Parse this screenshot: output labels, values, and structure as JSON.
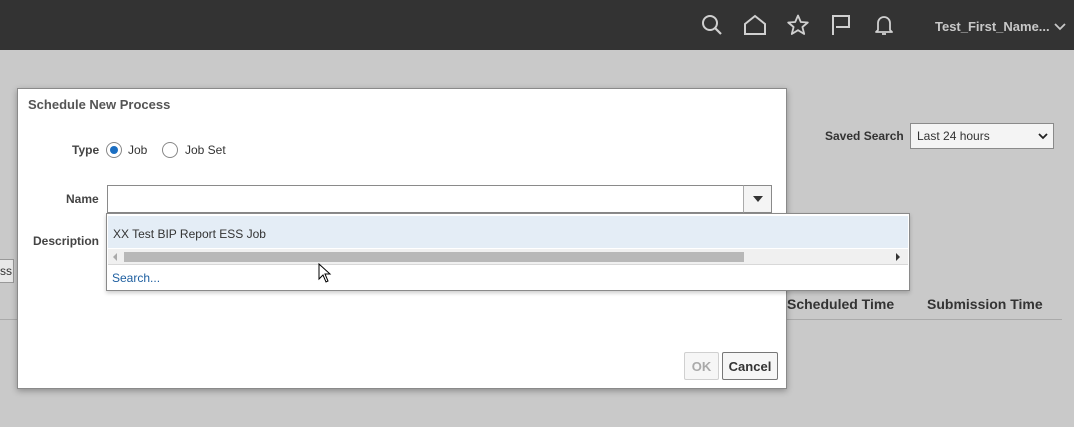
{
  "header": {
    "icons": [
      "search-icon",
      "home-icon",
      "favorites-star-icon",
      "watchlist-flag-icon",
      "notifications-bell-icon"
    ],
    "user_name": "Test_First_Name..."
  },
  "background": {
    "saved_search_label": "Saved Search",
    "saved_search_value": "Last 24 hours",
    "stub_text": "ss",
    "columns": [
      "Scheduled Time",
      "Submission Time"
    ]
  },
  "dialog": {
    "title": "Schedule New Process",
    "type_label": "Type",
    "type_options": [
      "Job",
      "Job Set"
    ],
    "type_selected": "Job",
    "name_label": "Name",
    "name_value": "",
    "description_label": "Description",
    "ok_label": "OK",
    "cancel_label": "Cancel"
  },
  "name_dropdown": {
    "items": [
      "XX Test BIP Report ESS Job"
    ],
    "search_link": "Search..."
  },
  "colors": {
    "header_bg": "#333333",
    "accent_blue": "#1b6ec2",
    "highlight_row": "#e4edf6"
  }
}
